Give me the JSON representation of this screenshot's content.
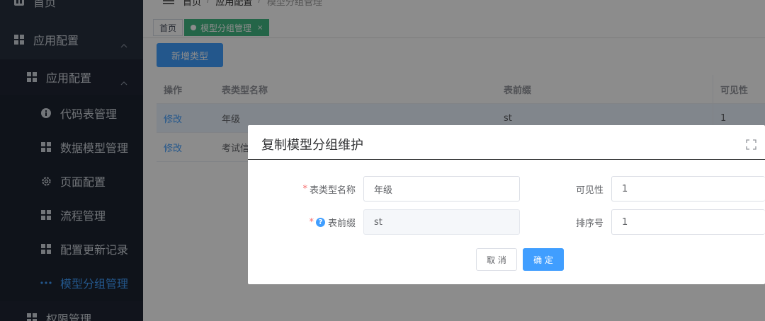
{
  "sidebar": {
    "items": [
      {
        "label": "首页",
        "icon": "dashboard-icon"
      },
      {
        "label": "应用配置",
        "icon": "grid-icon"
      },
      {
        "label": "应用配置",
        "icon": "grid-icon"
      },
      {
        "label": "代码表管理",
        "icon": "info-icon"
      },
      {
        "label": "数据模型管理",
        "icon": "grid-icon"
      },
      {
        "label": "页面配置",
        "icon": "gear-icon"
      },
      {
        "label": "流程管理",
        "icon": "grid-icon"
      },
      {
        "label": "配置更新记录",
        "icon": "grid-icon"
      },
      {
        "label": "模型分组管理",
        "icon": "more-dots-icon"
      },
      {
        "label": "权限管理",
        "icon": "grid-icon"
      }
    ]
  },
  "breadcrumb": {
    "items": [
      "首页",
      "应用配置",
      "模型分组管理"
    ],
    "sep": "/"
  },
  "tags": {
    "home": "首页",
    "active": "模型分组管理",
    "close": "×"
  },
  "toolbar": {
    "add_label": "新增类型"
  },
  "table": {
    "columns": [
      "操作",
      "表类型名称",
      "表前缀",
      "可见性"
    ],
    "rows": [
      {
        "action": "修改",
        "name": "年级",
        "prefix": "st",
        "visible": "1"
      },
      {
        "action": "修改",
        "name": "考试信息",
        "prefix": "",
        "visible": ""
      }
    ]
  },
  "dialog": {
    "title": "复制模型分组维护",
    "fields": {
      "name_label": "表类型名称",
      "name_value": "年级",
      "prefix_label": "表前缀",
      "prefix_value": "st",
      "visible_label": "可见性",
      "visible_value": "1",
      "order_label": "排序号",
      "order_value": "1",
      "required_mark": "*",
      "help_mark": "?"
    },
    "cancel_label": "取 消",
    "ok_label": "确 定"
  },
  "colors": {
    "primary": "#409eff",
    "tag_active": "#42b983",
    "sidebar_bg": "#27303f",
    "required": "#f56c6c"
  }
}
